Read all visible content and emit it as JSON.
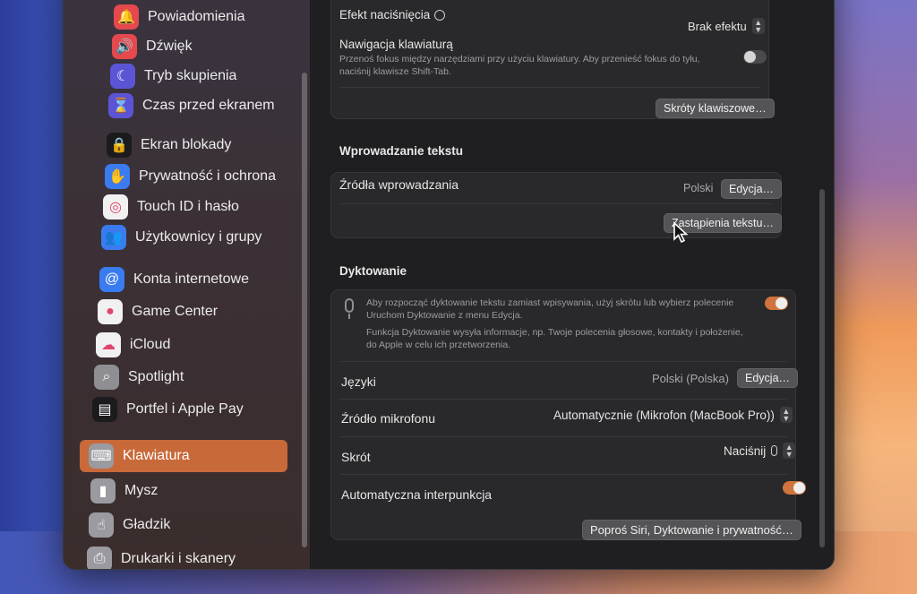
{
  "sidebar": {
    "items": [
      {
        "label": "Powiadomienia",
        "icon": "bell-icon",
        "color": "#e5484d",
        "active": false
      },
      {
        "label": "Dźwięk",
        "icon": "speaker-icon",
        "color": "#e5484d",
        "active": false
      },
      {
        "label": "Tryb skupienia",
        "icon": "moon-icon",
        "color": "#5b55d6",
        "active": false
      },
      {
        "label": "Czas przed ekranem",
        "icon": "hourglass-icon",
        "color": "#5b55d6",
        "active": false
      },
      {
        "label": "Ekran blokady",
        "icon": "lock-icon",
        "color": "#1b1b1d",
        "active": false
      },
      {
        "label": "Prywatność i ochrona",
        "icon": "hand-icon",
        "color": "#3a7bf0",
        "active": false
      },
      {
        "label": "Touch ID i hasło",
        "icon": "fingerprint-icon",
        "color": "#f1f1f1",
        "active": false
      },
      {
        "label": "Użytkownicy i grupy",
        "icon": "users-icon",
        "color": "#3a7bf0",
        "active": false
      },
      {
        "label": "Konta internetowe",
        "icon": "at-icon",
        "color": "#3a7bf0",
        "active": false
      },
      {
        "label": "Game Center",
        "icon": "game-center-icon",
        "color": "#f1f1f1",
        "active": false
      },
      {
        "label": "iCloud",
        "icon": "cloud-icon",
        "color": "#f1f1f1",
        "active": false
      },
      {
        "label": "Spotlight",
        "icon": "magnifier-icon",
        "color": "#8e8e93",
        "active": false
      },
      {
        "label": "Portfel i Apple Pay",
        "icon": "wallet-icon",
        "color": "#1b1b1d",
        "active": false
      },
      {
        "label": "Klawiatura",
        "icon": "keyboard-icon",
        "color": "#9a9aa0",
        "active": true
      },
      {
        "label": "Mysz",
        "icon": "mouse-icon",
        "color": "#9a9aa0",
        "active": false
      },
      {
        "label": "Gładzik",
        "icon": "trackpad-icon",
        "color": "#9a9aa0",
        "active": false
      },
      {
        "label": "Drukarki i skanery",
        "icon": "printer-icon",
        "color": "#9a9aa0",
        "active": false
      }
    ]
  },
  "keyboard_nav": {
    "effect_label": "Efekt naciśnięcia",
    "effect_value": "Brak efektu",
    "nav_label": "Nawigacja klawiaturą",
    "nav_desc_1": "Przenoś fokus między narzędziami przy użyciu klawiatury. Aby przenieść fokus do tyłu,",
    "nav_desc_2": "naciśnij klawisze Shift-Tab.",
    "shortcuts_button": "Skróty klawiszowe…"
  },
  "text_input": {
    "title": "Wprowadzanie tekstu",
    "sources_label": "Źródła wprowadzania",
    "sources_value": "Polski",
    "edit_button": "Edycja…",
    "replacements_button": "Zastąpienia tekstu…"
  },
  "dictation": {
    "title": "Dyktowanie",
    "desc_1": "Aby rozpocząć dyktowanie tekstu zamiast wpisywania, użyj skrótu lub wybierz polecenie",
    "desc_2": "Uruchom Dyktowanie z menu Edycja.",
    "desc_3": "Funkcja Dyktowanie wysyła informacje, np. Twoje polecenia głosowe, kontakty i położenie,",
    "desc_4": "do Apple w celu ich przetworzenia.",
    "languages_label": "Języki",
    "languages_value": "Polski (Polska)",
    "languages_edit": "Edycja…",
    "mic_label": "Źródło mikrofonu",
    "mic_value": "Automatycznie (Mikrofon (MacBook Pro))",
    "shortcut_label": "Skrót",
    "shortcut_value": "Naciśnij",
    "punct_label": "Automatyczna interpunkcja",
    "siri_button": "Poproś Siri, Dyktowanie i prywatność…"
  },
  "colors": {
    "accent": "#d1733e",
    "active_sidebar": "#c8693a"
  }
}
